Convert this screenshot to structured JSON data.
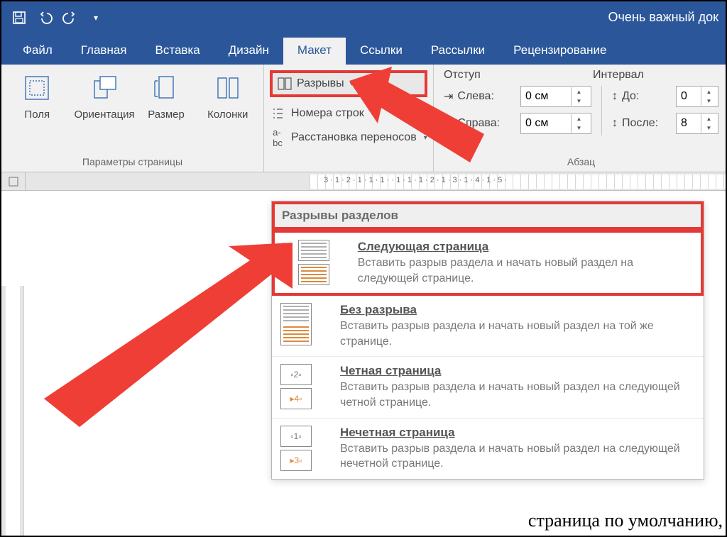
{
  "window": {
    "title": "Очень важный док"
  },
  "tabs": {
    "file": "Файл",
    "home": "Главная",
    "insert": "Вставка",
    "design": "Дизайн",
    "layout": "Макет",
    "references": "Ссылки",
    "mailings": "Рассылки",
    "review": "Рецензирование"
  },
  "page_setup": {
    "margins": "Поля",
    "orientation": "Ориентация",
    "size": "Размер",
    "columns": "Колонки",
    "breaks": "Разрывы",
    "line_numbers": "Номера строк",
    "hyphenation": "Расстановка переносов",
    "group_label": "Параметры страницы"
  },
  "paragraph": {
    "indent_header": "Отступ",
    "spacing_header": "Интервал",
    "left": "Слева:",
    "right": "Справа:",
    "before": "До:",
    "after": "После:",
    "left_val": "0 см",
    "right_val": "0 см",
    "before_val": "0",
    "after_val": "8",
    "group_label": "Абзац"
  },
  "dropdown": {
    "section_header": "Разрывы разделов",
    "items": [
      {
        "title": "Следующая страница",
        "desc": "Вставить разрыв раздела и начать новый раздел на следующей странице."
      },
      {
        "title": "Без разрыва",
        "desc": "Вставить разрыв раздела и начать новый раздел на той же странице."
      },
      {
        "title": "Четная страница",
        "desc": "Вставить разрыв раздела и начать новый раздел на следующей четной странице."
      },
      {
        "title": "Нечетная страница",
        "desc": "Вставить разрыв раздела и начать новый раздел на следующей нечетной странице."
      }
    ]
  },
  "ruler": {
    "labels": "3 · 1 · 2 · 1 · 1 · 1 ·   · 1 · 1 · 1 · 2 · 1 · 3 · 1 · 4 · 1 · 5 ·"
  },
  "body_text": "страница по умолчанию,"
}
